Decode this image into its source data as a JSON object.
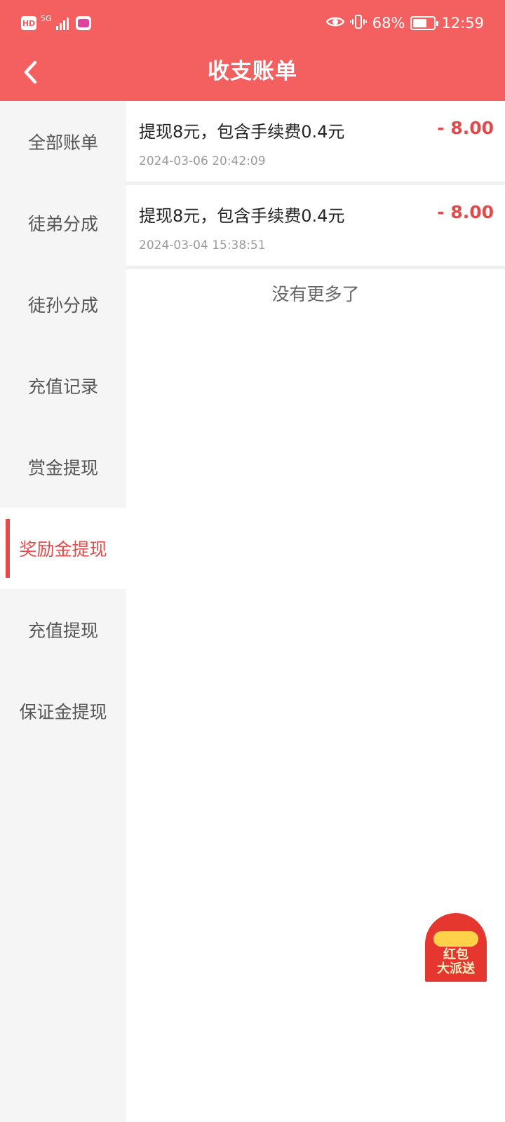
{
  "status_bar": {
    "hd_label": "HD",
    "network_label": "5G",
    "battery_percent": "68%",
    "battery_level": 0.68,
    "time": "12:59"
  },
  "header": {
    "title": "收支账单"
  },
  "sidebar": {
    "items": [
      {
        "label": "全部账单"
      },
      {
        "label": "徒弟分成"
      },
      {
        "label": "徒孙分成"
      },
      {
        "label": "充值记录"
      },
      {
        "label": "赏金提现"
      },
      {
        "label": "奖励金提现"
      },
      {
        "label": "充值提现"
      },
      {
        "label": "保证金提现"
      }
    ],
    "active_index": 5
  },
  "bills": [
    {
      "title": "提现8元，包含手续费0.4元",
      "amount": "- 8.00",
      "time": "2024-03-06 20:42:09"
    },
    {
      "title": "提现8元，包含手续费0.4元",
      "amount": "- 8.00",
      "time": "2024-03-04 15:38:51"
    }
  ],
  "list_footer": "没有更多了",
  "floating_promo": {
    "line1": "红包",
    "line2": "大派送"
  },
  "colors": {
    "header_bg": "#f46060",
    "accent_red": "#e44c4c",
    "sidebar_bg": "#f5f5f5"
  }
}
